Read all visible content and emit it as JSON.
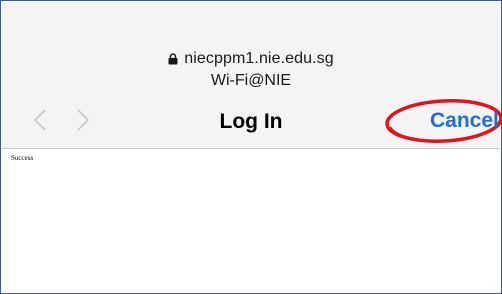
{
  "header": {
    "address": "niecppm1.nie.edu.sg",
    "network_name": "Wi-Fi@NIE",
    "title": "Log In",
    "cancel_label": "Cancel"
  },
  "icons": {
    "lock": "lock-icon",
    "back": "chevron-left-icon",
    "forward": "chevron-right-icon"
  },
  "content": {
    "message": "Success"
  },
  "colors": {
    "accent": "#1f6fd6",
    "annotation": "#e0141c",
    "bar_background": "#f4f4f5",
    "disabled_chevron": "#c7c7cc"
  }
}
